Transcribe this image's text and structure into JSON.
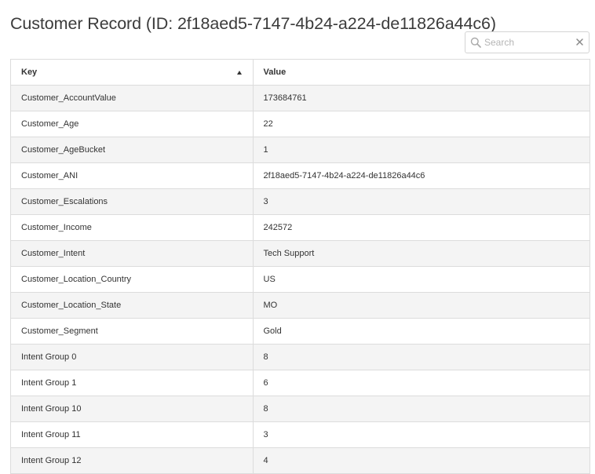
{
  "page": {
    "title": "Customer Record (ID: 2f18aed5-7147-4b24-a224-de11826a44c6)"
  },
  "search": {
    "placeholder": "Search",
    "value": "",
    "icon": "search-icon",
    "clear_icon": "close-icon"
  },
  "table": {
    "columns": [
      {
        "label": "Key",
        "sort": "ascending"
      },
      {
        "label": "Value"
      }
    ],
    "rows": [
      {
        "key": "Customer_AccountValue",
        "value": "173684761"
      },
      {
        "key": "Customer_Age",
        "value": "22"
      },
      {
        "key": "Customer_AgeBucket",
        "value": "1"
      },
      {
        "key": "Customer_ANI",
        "value": "2f18aed5-7147-4b24-a224-de11826a44c6"
      },
      {
        "key": "Customer_Escalations",
        "value": "3"
      },
      {
        "key": "Customer_Income",
        "value": "242572"
      },
      {
        "key": "Customer_Intent",
        "value": "Tech Support"
      },
      {
        "key": "Customer_Location_Country",
        "value": "US"
      },
      {
        "key": "Customer_Location_State",
        "value": "MO"
      },
      {
        "key": "Customer_Segment",
        "value": "Gold"
      },
      {
        "key": "Intent Group 0",
        "value": "8"
      },
      {
        "key": "Intent Group 1",
        "value": "6"
      },
      {
        "key": "Intent Group 10",
        "value": "8"
      },
      {
        "key": "Intent Group 11",
        "value": "3"
      },
      {
        "key": "Intent Group 12",
        "value": "4"
      }
    ]
  },
  "colors": {
    "border": "#dcdcdc",
    "stripe": "#f4f4f4",
    "text": "#333333"
  }
}
